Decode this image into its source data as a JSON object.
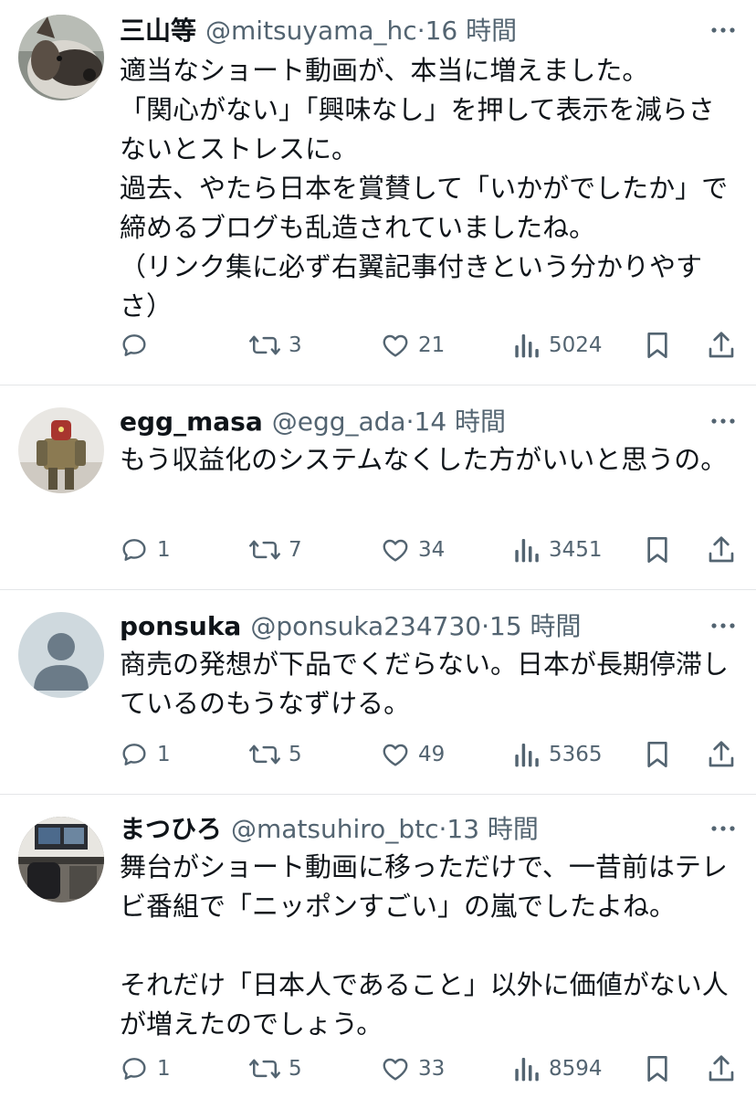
{
  "tweets": [
    {
      "name": "三山等",
      "handle": "@mitsuyama_hc",
      "separator": "·",
      "time": "16 時間",
      "body": "適当なショート動画が、本当に増えました。\n「関心がない」「興味なし」を押して表示を減らさないとストレスに。\n過去、やたら日本を賞賛して「いかがでしたか」で締めるブログも乱造されていましたね。\n（リンク集に必ず右翼記事付きという分かりやすさ）",
      "replies": "",
      "retweets": "3",
      "likes": "21",
      "views": "5024",
      "avatar": "dog-photo"
    },
    {
      "name": "egg_masa",
      "handle": "@egg_ada",
      "separator": "·",
      "time": "14 時間",
      "body": "もう収益化のシステムなくした方がいいと思うの。",
      "replies": "1",
      "retweets": "7",
      "likes": "34",
      "views": "3451",
      "avatar": "robot-figure-photo"
    },
    {
      "name": "ponsuka",
      "handle": "@ponsuka234730",
      "separator": "·",
      "time": "15 時間",
      "body": "商売の発想が下品でくだらない。日本が長期停滞しているのもうなずける。",
      "replies": "1",
      "retweets": "5",
      "likes": "49",
      "views": "5365",
      "avatar": "default-avatar"
    },
    {
      "name": "まつひろ",
      "handle": "@matsuhiro_btc",
      "separator": "·",
      "time": "13 時間",
      "body": "舞台がショート動画に移っただけで、一昔前はテレビ番組で「ニッポンすごい」の嵐でしたよね。\n\nそれだけ「日本人であること」以外に価値がない人が増えたのでしょう。",
      "replies": "1",
      "retweets": "5",
      "likes": "33",
      "views": "8594",
      "avatar": "desk-setup-photo"
    }
  ],
  "icons": {
    "reply": "speech-bubble-icon",
    "retweet": "retweet-arrows-icon",
    "like": "heart-icon",
    "views": "bar-chart-icon",
    "bookmark": "bookmark-icon",
    "share": "share-icon",
    "more": "more-dots-icon"
  },
  "colors": {
    "text": "#0f1419",
    "secondary": "#536471",
    "divider": "#e4e6e8"
  }
}
